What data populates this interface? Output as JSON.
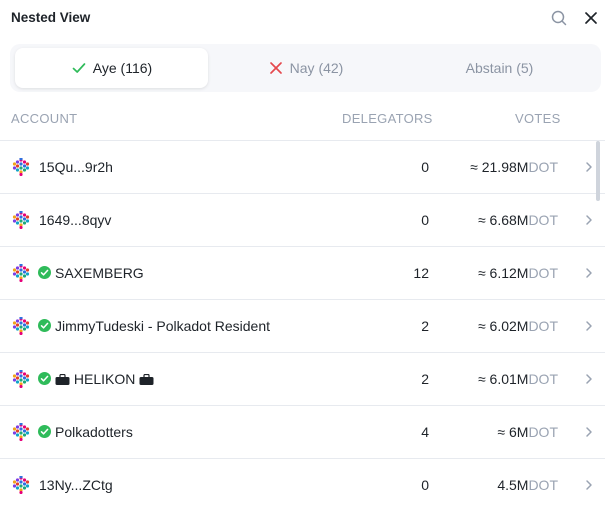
{
  "header": {
    "title": "Nested View",
    "search_icon": "search-icon",
    "close_icon": "close-icon"
  },
  "tabs": [
    {
      "label": "Aye (116)",
      "icon": "check-icon",
      "icon_color": "#2fbb5a",
      "active": true
    },
    {
      "label": "Nay (42)",
      "icon": "cross-icon",
      "icon_color": "#e5484d",
      "active": false
    },
    {
      "label": "Abstain (5)",
      "active": false
    }
  ],
  "columns": {
    "account": "ACCOUNT",
    "delegators": "DELEGATORS",
    "votes": "VOTES"
  },
  "rows": [
    {
      "name": "15Qu...9r2h",
      "verified": false,
      "delegators": "0",
      "votes": "≈ 21.98M",
      "unit": "DOT"
    },
    {
      "name": "1649...8qyv",
      "verified": false,
      "delegators": "0",
      "votes": "≈ 6.68M",
      "unit": "DOT"
    },
    {
      "name": "SAXEMBERG",
      "verified": true,
      "delegators": "12",
      "votes": "≈ 6.12M",
      "unit": "DOT"
    },
    {
      "name": "JimmyTudeski - Polkadot Resident",
      "verified": true,
      "delegators": "2",
      "votes": "≈ 6.02M",
      "unit": "DOT"
    },
    {
      "name": "HELIKON",
      "verified": true,
      "business_icons": true,
      "delegators": "2",
      "votes": "≈ 6.01M",
      "unit": "DOT"
    },
    {
      "name": "Polkadotters",
      "verified": true,
      "delegators": "4",
      "votes": "≈ 6M",
      "unit": "DOT"
    },
    {
      "name": "13Ny...ZCtg",
      "verified": false,
      "delegators": "0",
      "votes": "4.5M",
      "unit": "DOT"
    }
  ],
  "colors": {
    "accent_green": "#2fbb5a",
    "accent_red": "#e5484d",
    "muted": "#9aa3b2"
  }
}
